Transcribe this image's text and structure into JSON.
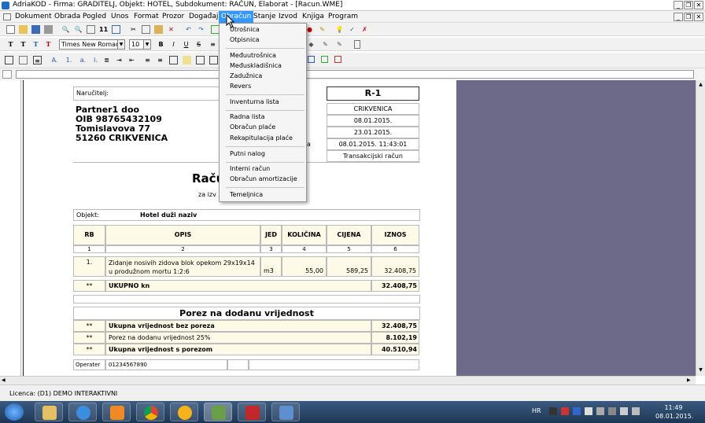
{
  "window": {
    "title": "AdriaKOD - Firma: GRADITELJ,   Objekt: HOTEL,   Subdokument: RAČUN,  Elaborat - [Racun.WME]"
  },
  "menu": [
    "Dokument",
    "Obrada",
    "Pogled",
    "Unos",
    "Format",
    "Prozor",
    "Događaji",
    "Obračun",
    "Stanje",
    "Izvod",
    "Knjiga",
    "Program"
  ],
  "toolbar": {
    "font": "Times New Roman",
    "size": "10",
    "bold": "B",
    "italic": "I",
    "underline": "U",
    "strike": "S",
    "undo_label": "11"
  },
  "dropdown": {
    "items": [
      "Utrošnica",
      "Otpisnica",
      "Međuutrošnica",
      "Međuskladišnica",
      "Zadužnica",
      "Revers",
      "Inventurna lista",
      "Radna lista",
      "Obračun plaće",
      "Rekapitulacija plaće",
      "Putni nalog",
      "Interni račun",
      "Obračun amortizacije",
      "Temeljnica"
    ]
  },
  "doc": {
    "narucitelj_label": "Naručitelj:",
    "customer": [
      "Partner1 doo",
      "OIB 98765432109",
      "Tomislavova 77",
      "51260 CRIKVENICA"
    ],
    "doc_no": "R-1",
    "right_vals": [
      "CRIKVENICA",
      "08.01.2015.",
      "23.01.2015.",
      "08.01.2015. 11:43:01",
      "Transakcijski račun"
    ],
    "right_label_frag": "a",
    "title_frag": "Raču",
    "subtitle_frag": "za izv",
    "objekt_label": "Objekt:",
    "objekt_val": "Hotel duži naziv",
    "headers": [
      "RB",
      "OPIS",
      "JED",
      "KOLIČINA",
      "CIJENA",
      "IZNOS"
    ],
    "colnums": [
      "1",
      "2",
      "3",
      "4",
      "5",
      "6"
    ],
    "row": {
      "rb": "1.",
      "opis1": "Zidanje nosivih zidova blok opekom 29x19x14",
      "opis2": "u produžnom mortu 1:2:6",
      "jed": "m3",
      "kol": "55,00",
      "cij": "589,25",
      "izn": "32.408,75"
    },
    "total": {
      "mark": "**",
      "label": "UKUPNO kn",
      "value": "32.408,75"
    },
    "pdv_title": "Porez na dodanu vrijednost",
    "pdv_rows": [
      {
        "mark": "**",
        "label": "Ukupna vrijednost bez poreza",
        "value": "32.408,75"
      },
      {
        "mark": "**",
        "label": "Porez na dodanu vrijednost 25%",
        "value": "8.102,19"
      },
      {
        "mark": "**",
        "label": "Ukupna vrijednost s porezom",
        "value": "40.510,94"
      }
    ],
    "operater_label": "Operater",
    "operater_val": "01234567890"
  },
  "status": {
    "licence": "Licenca:  (D1) DEMO INTERAKTIVNI"
  },
  "tray": {
    "lang": "HR",
    "time": "11:49",
    "date": "08.01.2015."
  }
}
